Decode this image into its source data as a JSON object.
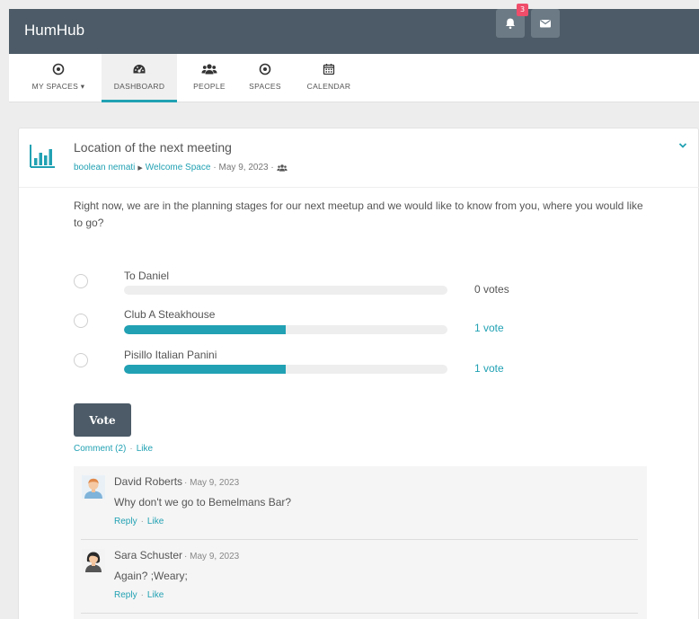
{
  "brand": {
    "title": "HumHub"
  },
  "notifications": {
    "count": "3"
  },
  "nav": {
    "my_spaces": "MY SPACES",
    "dashboard": "DASHBOARD",
    "people": "PEOPLE",
    "spaces": "SPACES",
    "calendar": "CALENDAR"
  },
  "post": {
    "title": "Location of the next meeting",
    "author": "boolean nemati",
    "space": "Welcome Space",
    "date": "· May 9, 2023 ·",
    "description": "Right now, we are in the planning stages for our next meetup and we would like to know from you, where you would like to go?"
  },
  "poll": {
    "options": [
      {
        "label": "To Daniel",
        "votes": "0 votes",
        "percent": 0
      },
      {
        "label": "Club A Steakhouse",
        "votes": "1 vote",
        "percent": 50
      },
      {
        "label": "Pisillo Italian Panini",
        "votes": "1 vote",
        "percent": 50
      }
    ],
    "vote_button": "Vote"
  },
  "post_actions": {
    "comment": "Comment (2)",
    "like": "Like",
    "separator": "·"
  },
  "comments": [
    {
      "author": "David Roberts",
      "date": "· May 9, 2023",
      "text": "Why don't we go to Bemelmans Bar?",
      "reply": "Reply",
      "like": "Like"
    },
    {
      "author": "Sara Schuster",
      "date": "· May 9, 2023",
      "text": "Again? ;Weary;",
      "reply": "Reply",
      "like": "Like"
    }
  ],
  "colors": {
    "topbar": "#4c5b67",
    "accent": "#21a1b3",
    "badge": "#ef4d6a"
  }
}
